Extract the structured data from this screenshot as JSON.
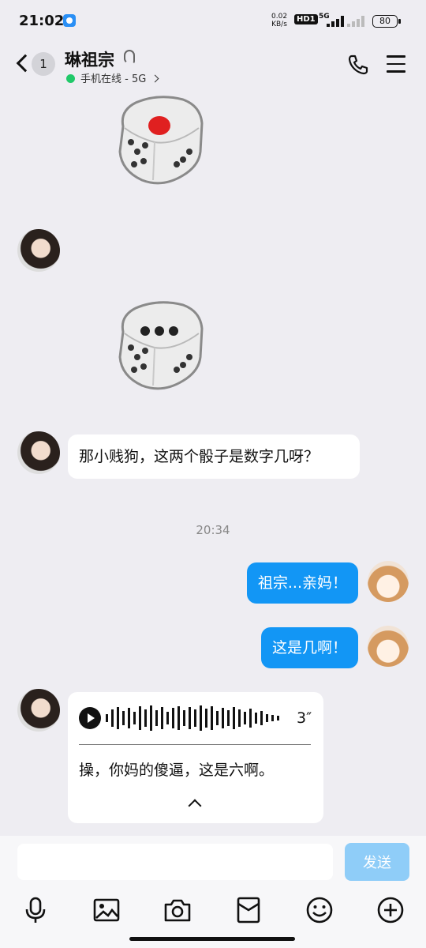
{
  "status_bar": {
    "time": "21:02",
    "speed_value": "0.02",
    "speed_unit": "KB/s",
    "hd_label": "HD1",
    "network_label": "5G",
    "battery": "80"
  },
  "header": {
    "contact_name": "琳祖宗",
    "online_status": "手机在线 - 5G",
    "unread_count": "1"
  },
  "messages": {
    "question_text": "那小贱狗，这两个骰子是数字几呀？",
    "timestamp": "20:34",
    "reply1": "祖宗...亲妈！",
    "reply2": "这是几啊！",
    "voice_duration": "3″",
    "voice_transcript": "操，你妈的傻逼，这是六啊。"
  },
  "dice_values": [
    1,
    3
  ],
  "input": {
    "placeholder": "",
    "send_label": "发送"
  },
  "colors": {
    "accent": "#1296f5",
    "send_disabled": "#8fcdf8",
    "online": "#20c969"
  }
}
